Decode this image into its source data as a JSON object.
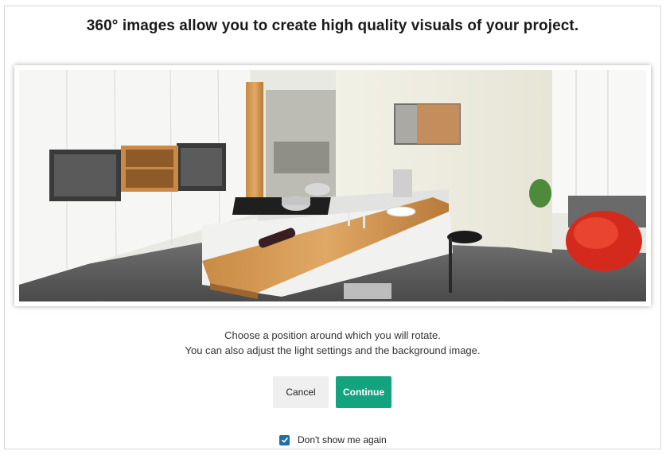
{
  "dialog": {
    "title": "360° images allow you to create high quality visuals of your project.",
    "preview_image": "kitchen-360-render",
    "description": {
      "line1": "Choose a position around which you will rotate.",
      "line2": "You can also adjust the light settings and the background image."
    },
    "buttons": {
      "cancel_label": "Cancel",
      "continue_label": "Continue"
    },
    "dont_show_again": {
      "label": "Don't show me again",
      "checked": true
    },
    "colors": {
      "accent": "#14a37f",
      "checkbox": "#1e6fa8",
      "cancel_bg": "#efefef"
    }
  }
}
